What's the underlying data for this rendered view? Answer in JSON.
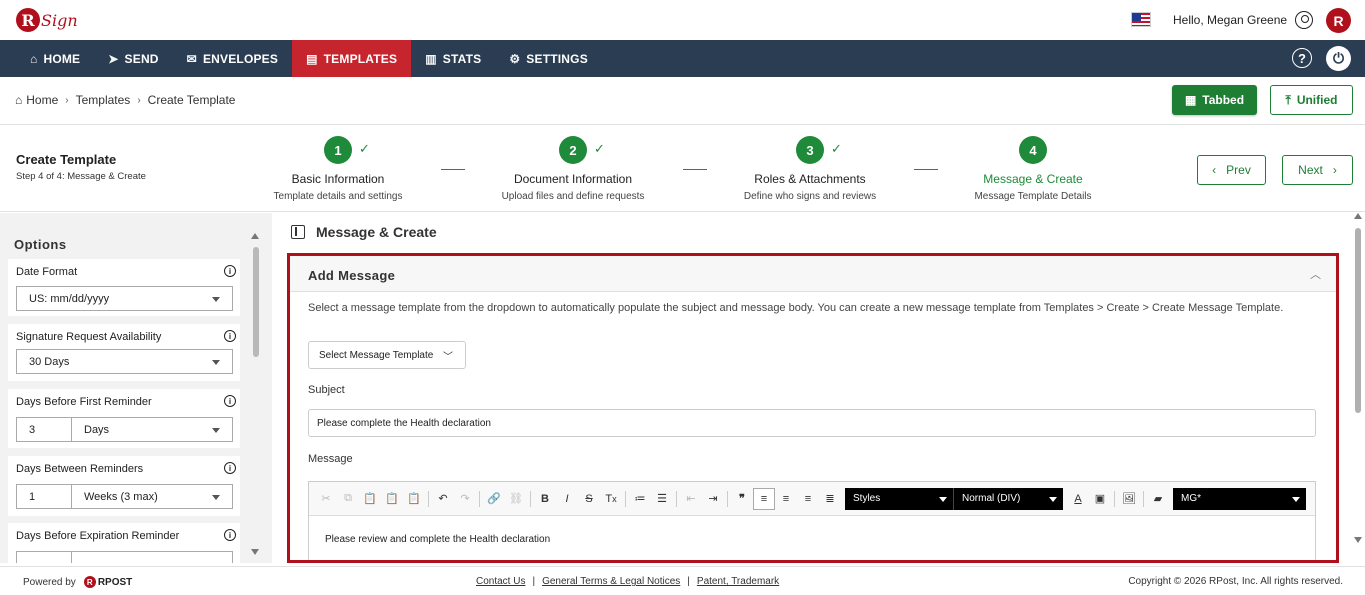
{
  "header": {
    "logo_text": "RSign",
    "greeting": "Hello, Megan Greene",
    "avatar_letter": "R"
  },
  "nav": {
    "items": [
      {
        "label": "HOME",
        "icon": "home-icon"
      },
      {
        "label": "SEND",
        "icon": "send-icon"
      },
      {
        "label": "ENVELOPES",
        "icon": "envelope-icon"
      },
      {
        "label": "TEMPLATES",
        "icon": "template-icon",
        "active": true
      },
      {
        "label": "STATS",
        "icon": "stats-icon"
      },
      {
        "label": "SETTINGS",
        "icon": "gear-icon"
      }
    ],
    "active_color": "#c6252d",
    "bg_color": "#2b3d52"
  },
  "breadcrumb": {
    "items": [
      "Home",
      "Templates",
      "Create Template"
    ]
  },
  "view_toggle": {
    "tabbed_label": "Tabbed",
    "unified_label": "Unified"
  },
  "stepper": {
    "title": "Create Template",
    "subtitle": "Step 4 of 4: Message & Create",
    "steps": [
      {
        "num": "1",
        "label": "Basic Information",
        "desc": "Template details and settings",
        "done": true
      },
      {
        "num": "2",
        "label": "Document Information",
        "desc": "Upload files and define requests",
        "done": true
      },
      {
        "num": "3",
        "label": "Roles & Attachments",
        "desc": "Define who signs and reviews",
        "done": true
      },
      {
        "num": "4",
        "label": "Message & Create",
        "desc": "Message Template Details",
        "done": false
      }
    ],
    "prev_label": "Prev",
    "next_label": "Next"
  },
  "options": {
    "heading": "Options",
    "date_format": {
      "label": "Date Format",
      "value": "US: mm/dd/yyyy"
    },
    "availability": {
      "label": "Signature Request Availability",
      "value": "30 Days"
    },
    "first_reminder": {
      "label": "Days Before First Reminder",
      "num": "3",
      "unit": "Days"
    },
    "between_reminders": {
      "label": "Days Between Reminders",
      "num": "1",
      "unit": "Weeks (3 max)"
    },
    "expiration_reminder": {
      "label": "Days Before Expiration Reminder"
    }
  },
  "main": {
    "title": "Message & Create",
    "panel_title": "Add Message",
    "help_text": "Select a message template from the dropdown to automatically populate the subject and message body. You can create a new message template from Templates > Create > Create Message Template.",
    "template_select": "Select Message Template",
    "subject_label": "Subject",
    "subject_value": "Please complete the Health declaration",
    "message_label": "Message",
    "styles_label": "Styles",
    "format_label": "Normal (DIV)",
    "mg_label": "MG*",
    "body_text": "Please review and complete the Health declaration"
  },
  "footer": {
    "powered_by": "Powered by",
    "brand": "RPOST",
    "links": [
      "Contact Us",
      "General Terms & Legal Notices",
      "Patent, Trademark"
    ],
    "copyright": "Copyright © 2026 RPost, Inc. All rights reserved."
  }
}
